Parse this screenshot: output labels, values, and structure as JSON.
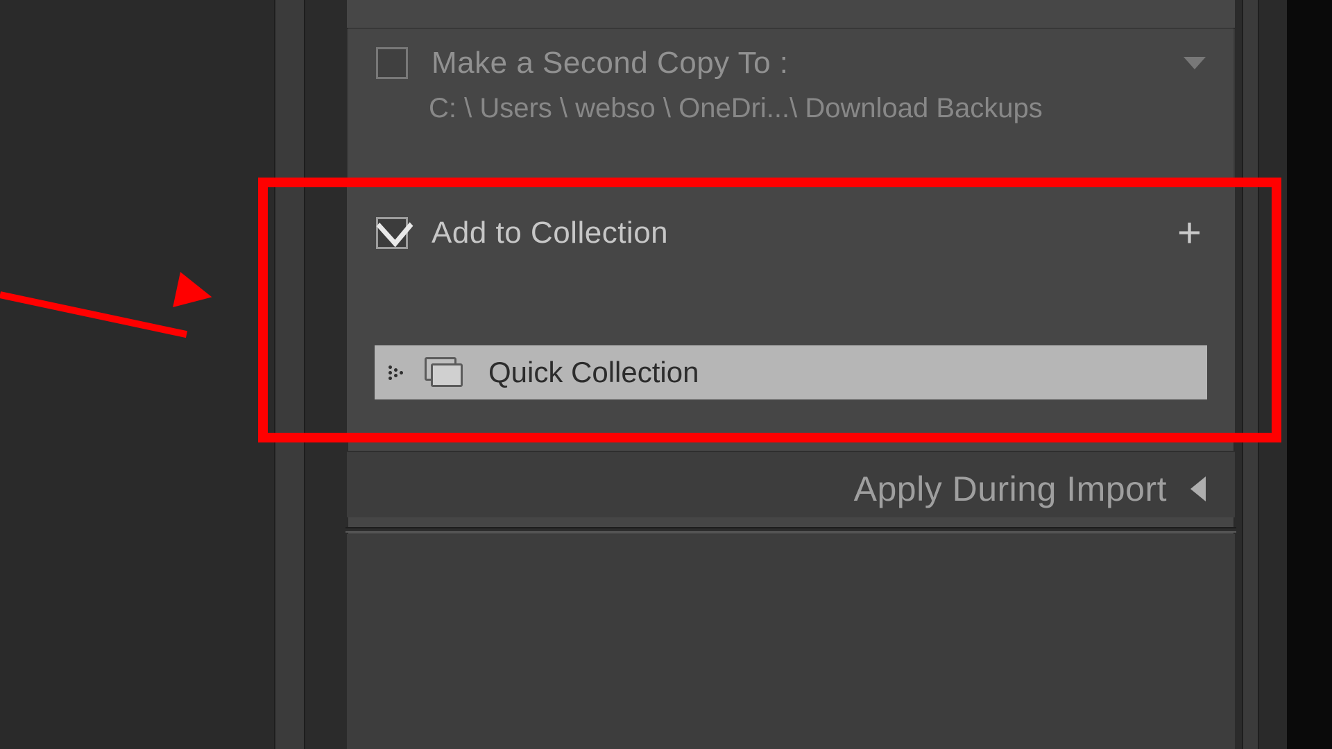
{
  "sections": {
    "secondCopy": {
      "label": "Make a Second Copy To :",
      "checked": false,
      "path": "C: \\ Users \\ webso \\ OneDri...\\ Download Backups"
    },
    "addToCollection": {
      "label": "Add to Collection",
      "checked": true,
      "selectedCollection": "Quick Collection"
    },
    "applyDuringImport": {
      "label": "Apply During Import"
    }
  },
  "annotation": {
    "color": "#ff0000"
  }
}
